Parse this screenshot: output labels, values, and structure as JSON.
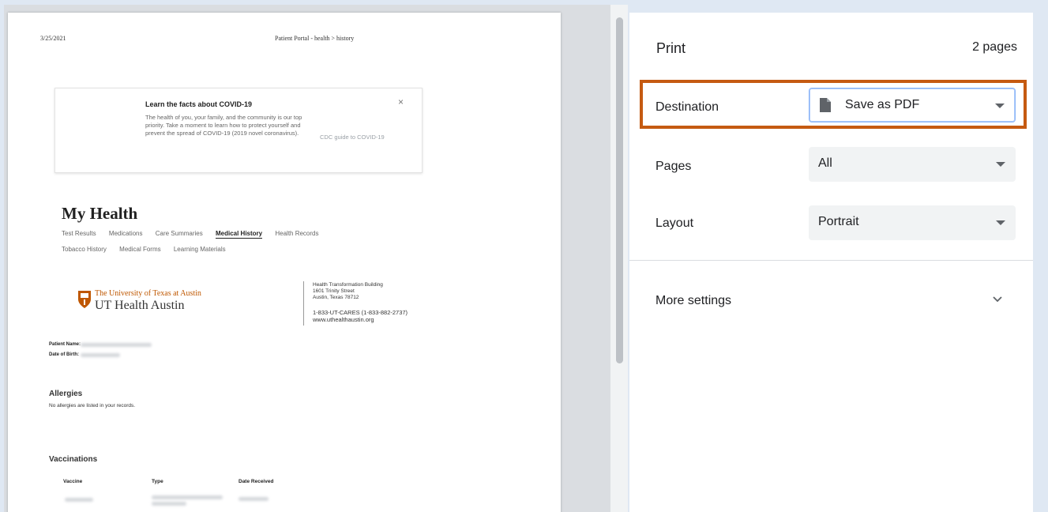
{
  "preview": {
    "header_date": "3/25/2021",
    "header_title": "Patient Portal - health > history",
    "covid_card": {
      "title": "Learn the facts about COVID-19",
      "body": "The health of you, your family, and the community is our top priority. Take a moment to learn how to protect yourself and prevent the spread of COVID-19 (2019 novel coronavirus).",
      "link": "CDC guide to COVID-19",
      "close_symbol": "×"
    },
    "page_heading": "My Health",
    "nav_row1": [
      "Test Results",
      "Medications",
      "Care Summaries",
      "Medical History",
      "Health Records"
    ],
    "nav_row2": [
      "Tobacco History",
      "Medical Forms",
      "Learning Materials"
    ],
    "logo": {
      "university": "The University of Texas at Austin",
      "name": "UT Health Austin"
    },
    "address": {
      "building": "Health Transformation Building",
      "street": "1601 Trinity Street",
      "city": "Austin, Texas 78712",
      "phone": "1-833-UT-CARES (1-833-882-2737)",
      "web": "www.uthealthaustin.org"
    },
    "patient_name_label": "Patient Name:",
    "dob_label": "Date of Birth:",
    "allergies_heading": "Allergies",
    "allergies_text": "No allergies are listed in your records.",
    "vaccinations_heading": "Vaccinations",
    "vaccine_columns": [
      "Vaccine",
      "Type",
      "Date Received"
    ]
  },
  "panel": {
    "title": "Print",
    "page_count": "2 pages",
    "destination_label": "Destination",
    "destination_value": "Save as PDF",
    "pages_label": "Pages",
    "pages_value": "All",
    "layout_label": "Layout",
    "layout_value": "Portrait",
    "more_settings": "More settings"
  },
  "colors": {
    "highlight": "#c55a11",
    "ut_orange": "#bf5700"
  }
}
